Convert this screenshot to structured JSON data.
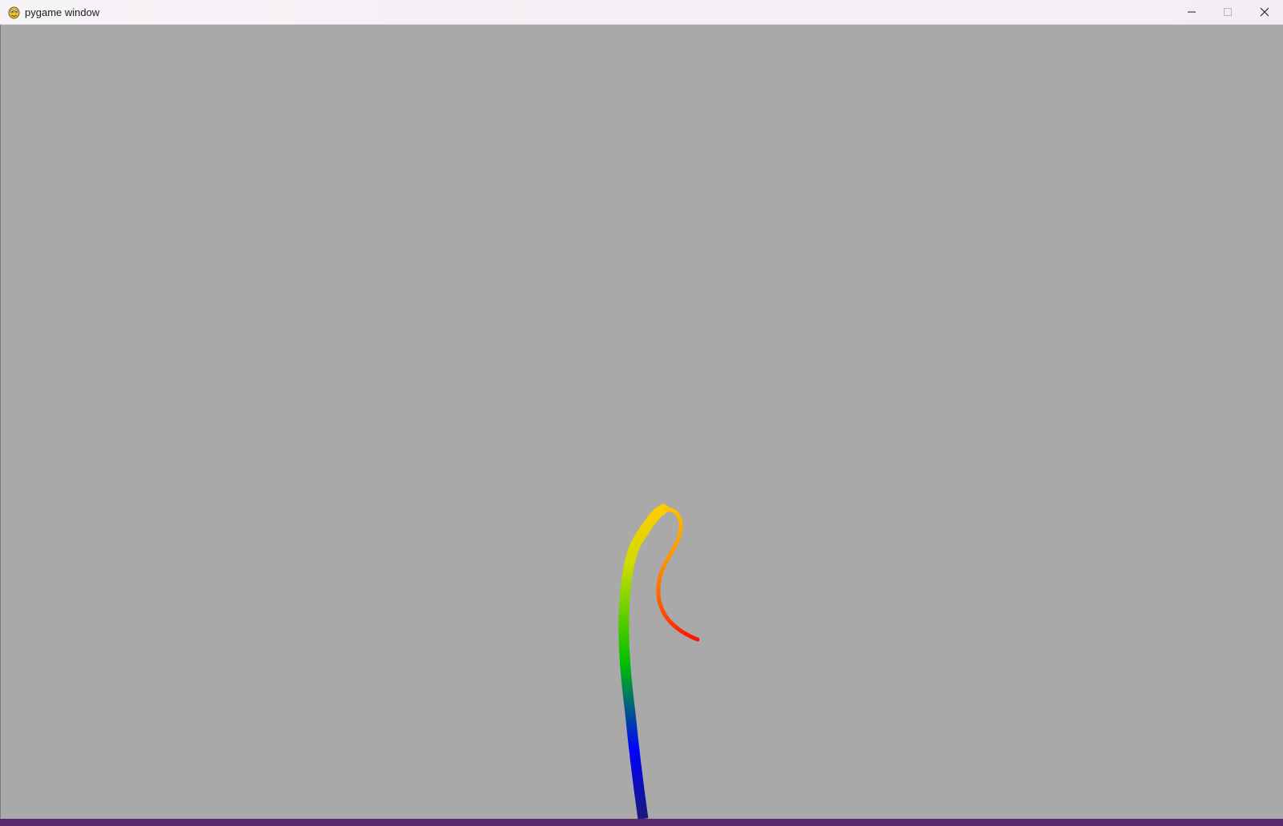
{
  "window": {
    "title": "pygame window",
    "icon": "pygame-snake-icon"
  },
  "title_controls": {
    "minimize_icon": "minimize-icon",
    "maximize_icon": "maximize-icon",
    "close_icon": "close-icon"
  },
  "canvas": {
    "background": "#a9a9a9",
    "stroke_gradient": [
      "#1a1a7a",
      "#0000ff",
      "#00c000",
      "#ffd700",
      "#ff8c00",
      "#ff0000"
    ]
  },
  "taskbar": {
    "color": "#5a2a6e"
  }
}
